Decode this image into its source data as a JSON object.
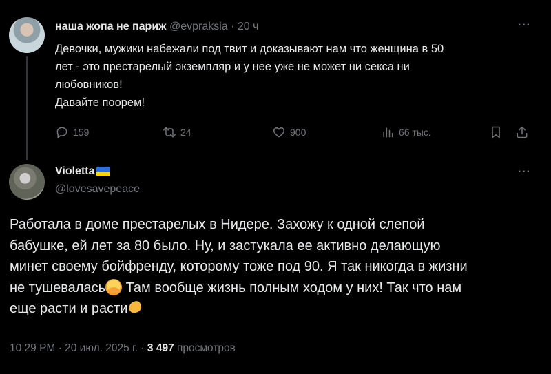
{
  "parent_tweet": {
    "author_name": "наша жопа не париж",
    "handle": "@evpraksia",
    "separator": "·",
    "time": "20 ч",
    "text": "Девочки, мужики набежали под твит и доказывают нам что женщина в 50\nлет - это престарелый экземпляр и у нее уже не может ни секса ни\nлюбовников!\nДавайте поорем!",
    "replies": "159",
    "reposts": "24",
    "likes": "900",
    "views": "66 тыс."
  },
  "main_tweet": {
    "author_name": "Violetta",
    "handle": "@lovesavepeace",
    "text_part1": "Работала в доме престарелых в Нидере. Захожу к одной слепой\nбабушке, ей лет за 80 было. Ну, и застукала ее активно делающую\nминет своему бойфренду, которому тоже под 90. Я так никогда в жизни\nне тушевалась",
    "text_part2": " Там вообще жизнь полным ходом у них! Так что нам\nеще расти и расти",
    "timestamp": "10:29 PM · 20 июл. 2025 г. · ",
    "views_count": "3 497",
    "views_label": " просмотров"
  },
  "icons": {
    "more": "more-horizontal-icon",
    "reply": "reply-icon",
    "repost": "repost-icon",
    "like": "heart-icon",
    "views": "views-chart-icon",
    "bookmark": "bookmark-icon",
    "share": "share-icon"
  },
  "colors": {
    "background": "#000000",
    "text_primary": "#e7e9ea",
    "text_secondary": "#71767b",
    "thread_line": "#333639"
  }
}
